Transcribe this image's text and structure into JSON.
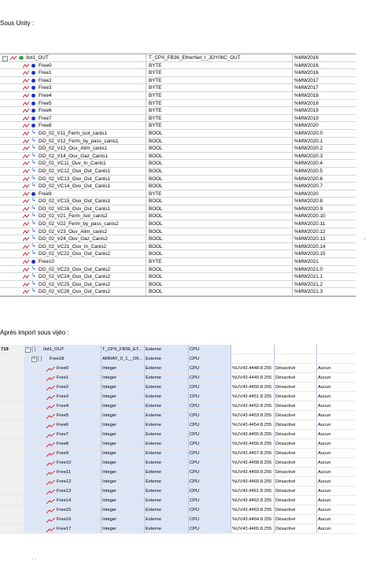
{
  "captions": {
    "unity": "Sous Unity :",
    "vijeo": "Après import sous vijéo :"
  },
  "unity_table": {
    "rows": [
      {
        "level": 0,
        "icon": "group-green-icon",
        "name": "Ilot1_OUT",
        "type": "T_CPX_FB36_EtherNet_I_JOY06C_OUT",
        "address": "%MW2016"
      },
      {
        "level": 1,
        "icon": "byte-dot-icon",
        "name": "Free0",
        "type": "BYTE",
        "address": "%MW2016"
      },
      {
        "level": 1,
        "icon": "byte-dot-icon",
        "name": "Free1",
        "type": "BYTE",
        "address": "%MW2016"
      },
      {
        "level": 1,
        "icon": "byte-dot-icon",
        "name": "Free2",
        "type": "BYTE",
        "address": "%MW2017"
      },
      {
        "level": 1,
        "icon": "byte-dot-icon",
        "name": "Free3",
        "type": "BYTE",
        "address": "%MW2017"
      },
      {
        "level": 1,
        "icon": "byte-dot-icon",
        "name": "Free4",
        "type": "BYTE",
        "address": "%MW2018"
      },
      {
        "level": 1,
        "icon": "byte-dot-icon",
        "name": "Free5",
        "type": "BYTE",
        "address": "%MW2018"
      },
      {
        "level": 1,
        "icon": "byte-dot-icon",
        "name": "Free6",
        "type": "BYTE",
        "address": "%MW2019"
      },
      {
        "level": 1,
        "icon": "byte-dot-icon",
        "name": "Free7",
        "type": "BYTE",
        "address": "%MW2019"
      },
      {
        "level": 1,
        "icon": "byte-dot-icon",
        "name": "Free8",
        "type": "BYTE",
        "address": "%MW2020"
      },
      {
        "level": 1,
        "icon": "bool-arrow-icon",
        "name": "DO_02_V11_Ferm_isol_canis1",
        "type": "BOOL",
        "address": "%MW2020.0"
      },
      {
        "level": 1,
        "icon": "bool-arrow-icon",
        "name": "DO_02_V12_Ferm_by_pass_canis1",
        "type": "BOOL",
        "address": "%MW2020.1"
      },
      {
        "level": 1,
        "icon": "bool-arrow-icon",
        "name": "DO_02_V13_Ouv_Alim_canis1",
        "type": "BOOL",
        "address": "%MW2020.2"
      },
      {
        "level": 1,
        "icon": "bool-arrow-icon",
        "name": "DO_02_V14_Ouv_Gaz_Canis1",
        "type": "BOOL",
        "address": "%MW2020.3"
      },
      {
        "level": 1,
        "icon": "bool-arrow-icon",
        "name": "DO_02_VC11_Ouv_In_Canis1",
        "type": "BOOL",
        "address": "%MW2020.4"
      },
      {
        "level": 1,
        "icon": "bool-arrow-icon",
        "name": "DO_02_VC12_Ouv_Out_Canis1",
        "type": "BOOL",
        "address": "%MW2020.5"
      },
      {
        "level": 1,
        "icon": "bool-arrow-icon",
        "name": "DO_02_VC13_Ouv_Out_Canis1",
        "type": "BOOL",
        "address": "%MW2020.6"
      },
      {
        "level": 1,
        "icon": "bool-arrow-icon",
        "name": "DO_02_VC14_Ouv_Out_Canis1",
        "type": "BOOL",
        "address": "%MW2020.7"
      },
      {
        "level": 1,
        "icon": "byte-dot-icon",
        "name": "Free9",
        "type": "BYTE",
        "address": "%MW2020"
      },
      {
        "level": 1,
        "icon": "bool-arrow-icon",
        "name": "DO_02_VC15_Ouv_Out_Canis1",
        "type": "BOOL",
        "address": "%MW2020.8"
      },
      {
        "level": 1,
        "icon": "bool-arrow-icon",
        "name": "DO_02_VC16_Ouv_Out_Canis1",
        "type": "BOOL",
        "address": "%MW2020.9"
      },
      {
        "level": 1,
        "icon": "bool-arrow-icon",
        "name": "DO_02_V21_Ferm_isol_canis2",
        "type": "BOOL",
        "address": "%MW2020.10"
      },
      {
        "level": 1,
        "icon": "bool-arrow-icon",
        "name": "DO_02_V22_Ferm_by_pass_canis2",
        "type": "BOOL",
        "address": "%MW2020.11"
      },
      {
        "level": 1,
        "icon": "bool-arrow-icon",
        "name": "DO_02_V23_Ouv_Alim_canis2",
        "type": "BOOL",
        "address": "%MW2020.12"
      },
      {
        "level": 1,
        "icon": "bool-arrow-icon",
        "name": "DO_02_V24_Ouv_Gaz_Canis2",
        "type": "BOOL",
        "address": "%MW2020.13"
      },
      {
        "level": 1,
        "icon": "bool-arrow-icon",
        "name": "DO_02_VC21_Ouv_In_Canis2",
        "type": "BOOL",
        "address": "%MW2020.14"
      },
      {
        "level": 1,
        "icon": "bool-arrow-icon",
        "name": "DO_02_VC22_Ouv_Out_Canis2",
        "type": "BOOL",
        "address": "%MW2020.15"
      },
      {
        "level": 1,
        "icon": "byte-dot-icon",
        "name": "Free10",
        "type": "BYTE",
        "address": "%MW2021"
      },
      {
        "level": 1,
        "icon": "bool-arrow-icon",
        "name": "DO_02_VC23_Ouv_Out_Canis2",
        "type": "BOOL",
        "address": "%MW2021.0"
      },
      {
        "level": 1,
        "icon": "bool-arrow-icon",
        "name": "DO_02_VC24_Ouv_Out_Canis2",
        "type": "BOOL",
        "address": "%MW2021.1"
      },
      {
        "level": 1,
        "icon": "bool-arrow-icon",
        "name": "DO_02_VC25_Ouv_Out_Canis2",
        "type": "BOOL",
        "address": "%MW2021.2"
      },
      {
        "level": 1,
        "icon": "bool-arrow-icon",
        "name": "DO_02_VC26_Ouv_Out_Canis2",
        "type": "BOOL",
        "address": "%MW2021.3"
      }
    ],
    "side_mark": "."
  },
  "vijeo_table": {
    "rows": [
      {
        "id": "719",
        "level": 0,
        "icon": "structure-braces-icon",
        "expand": "−",
        "name": "Ilot1_OUT",
        "type": "T_CPX_FB36_ET...",
        "source": "Externe",
        "scan": "CPU",
        "address": "",
        "state": "",
        "alarm": "",
        "style": "hl"
      },
      {
        "id": "",
        "level": 1,
        "icon": "array-bracket-icon",
        "expand": "+",
        "name": "Free18",
        "type": "ARRAY_0_1__OF...",
        "source": "Externe",
        "scan": "CPU",
        "address": "",
        "state": "",
        "alarm": "",
        "style": "hl"
      },
      {
        "id": "",
        "level": 2,
        "icon": "integer-wave-icon",
        "name": "Free0",
        "type": "Integer",
        "source": "Externe",
        "scan": "CPU",
        "address": "%UV43.4448.8.255",
        "state": "Désactivé",
        "alarm": "Aucun",
        "style": "hl"
      },
      {
        "id": "",
        "level": 2,
        "icon": "integer-wave-icon",
        "name": "Free1",
        "type": "Integer",
        "source": "Externe",
        "scan": "CPU",
        "address": "%UV43.4449.8.255",
        "state": "Désactivé",
        "alarm": "Aucun",
        "style": "hl"
      },
      {
        "id": "",
        "level": 2,
        "icon": "integer-wave-icon",
        "name": "Free2",
        "type": "Integer",
        "source": "Externe",
        "scan": "CPU",
        "address": "%UV43.4450.8.255",
        "state": "Désactivé",
        "alarm": "Aucun",
        "style": "hl"
      },
      {
        "id": "",
        "level": 2,
        "icon": "integer-wave-icon",
        "name": "Free3",
        "type": "Integer",
        "source": "Externe",
        "scan": "CPU",
        "address": "%UV43.4451.8.255",
        "state": "Désactivé",
        "alarm": "Aucun",
        "style": "hl"
      },
      {
        "id": "",
        "level": 2,
        "icon": "integer-wave-icon",
        "name": "Free4",
        "type": "Integer",
        "source": "Externe",
        "scan": "CPU",
        "address": "%UV43.4452.8.255",
        "state": "Désactivé",
        "alarm": "Aucun",
        "style": "hl"
      },
      {
        "id": "",
        "level": 2,
        "icon": "integer-wave-icon",
        "name": "Free5",
        "type": "Integer",
        "source": "Externe",
        "scan": "CPU",
        "address": "%UV43.4453.8.255",
        "state": "Désactivé",
        "alarm": "Aucun",
        "style": "hl"
      },
      {
        "id": "",
        "level": 2,
        "icon": "integer-wave-icon",
        "name": "Free6",
        "type": "Integer",
        "source": "Externe",
        "scan": "CPU",
        "address": "%UV43.4454.8.255",
        "state": "Désactivé",
        "alarm": "Aucun",
        "style": "hl"
      },
      {
        "id": "",
        "level": 2,
        "icon": "integer-wave-icon",
        "name": "Free7",
        "type": "Integer",
        "source": "Externe",
        "scan": "CPU",
        "address": "%UV43.4455.8.255",
        "state": "Désactivé",
        "alarm": "Aucun",
        "style": "hl"
      },
      {
        "id": "",
        "level": 2,
        "icon": "integer-wave-icon",
        "name": "Free8",
        "type": "Integer",
        "source": "Externe",
        "scan": "CPU",
        "address": "%UV43.4456.8.255",
        "state": "Désactivé",
        "alarm": "Aucun",
        "style": "hl"
      },
      {
        "id": "",
        "level": 2,
        "icon": "integer-wave-icon",
        "name": "Free9",
        "type": "Integer",
        "source": "Externe",
        "scan": "CPU",
        "address": "%UV43.4457.8.255",
        "state": "Désactivé",
        "alarm": "Aucun",
        "style": "hl"
      },
      {
        "id": "",
        "level": 2,
        "icon": "integer-wave-icon",
        "name": "Free10",
        "type": "Integer",
        "source": "Externe",
        "scan": "CPU",
        "address": "%UV43.4458.8.255",
        "state": "Désactivé",
        "alarm": "Aucun",
        "style": "hl"
      },
      {
        "id": "",
        "level": 2,
        "icon": "integer-wave-icon",
        "name": "Free11",
        "type": "Integer",
        "source": "Externe",
        "scan": "CPU",
        "address": "%UV43.4459.8.255",
        "state": "Désactivé",
        "alarm": "Aucun",
        "style": "hl"
      },
      {
        "id": "",
        "level": 2,
        "icon": "integer-wave-icon",
        "name": "Free12",
        "type": "Integer",
        "source": "Externe",
        "scan": "CPU",
        "address": "%UV43.4460.8.255",
        "state": "Désactivé",
        "alarm": "Aucun",
        "style": "hl"
      },
      {
        "id": "",
        "level": 2,
        "icon": "integer-wave-icon",
        "name": "Free13",
        "type": "Integer",
        "source": "Externe",
        "scan": "CPU",
        "address": "%UV43.4461.8.255",
        "state": "Désactivé",
        "alarm": "Aucun",
        "style": "hl"
      },
      {
        "id": "",
        "level": 2,
        "icon": "integer-wave-icon",
        "name": "Free14",
        "type": "Integer",
        "source": "Externe",
        "scan": "CPU",
        "address": "%UV43.4462.8.255",
        "state": "Désactivé",
        "alarm": "Aucun",
        "style": "hl"
      },
      {
        "id": "",
        "level": 2,
        "icon": "integer-wave-icon",
        "name": "Free15",
        "type": "Integer",
        "source": "Externe",
        "scan": "CPU",
        "address": "%UV43.4463.8.255",
        "state": "Désactivé",
        "alarm": "Aucun",
        "style": "hl"
      },
      {
        "id": "",
        "level": 2,
        "icon": "integer-wave-icon",
        "name": "Free16",
        "type": "Integer",
        "source": "Externe",
        "scan": "CPU",
        "address": "%UV43.4464.8.255",
        "state": "Désactivé",
        "alarm": "Aucun",
        "style": "hl"
      },
      {
        "id": "",
        "level": 2,
        "icon": "integer-wave-icon",
        "name": "Free17",
        "type": "Integer",
        "source": "Externe",
        "scan": "CPU",
        "address": "%UV43.4465.8.255",
        "state": "Désactivé",
        "alarm": "Aucun",
        "style": "hl"
      }
    ],
    "footer_mark": "· ·"
  },
  "colors": {
    "byte_dot": "#1f33c8",
    "group_dot": "#2fa84a",
    "bool_arrow": "#1e5ab4",
    "wave_red": "#d03030",
    "row_highlight": "#dde6f7"
  }
}
